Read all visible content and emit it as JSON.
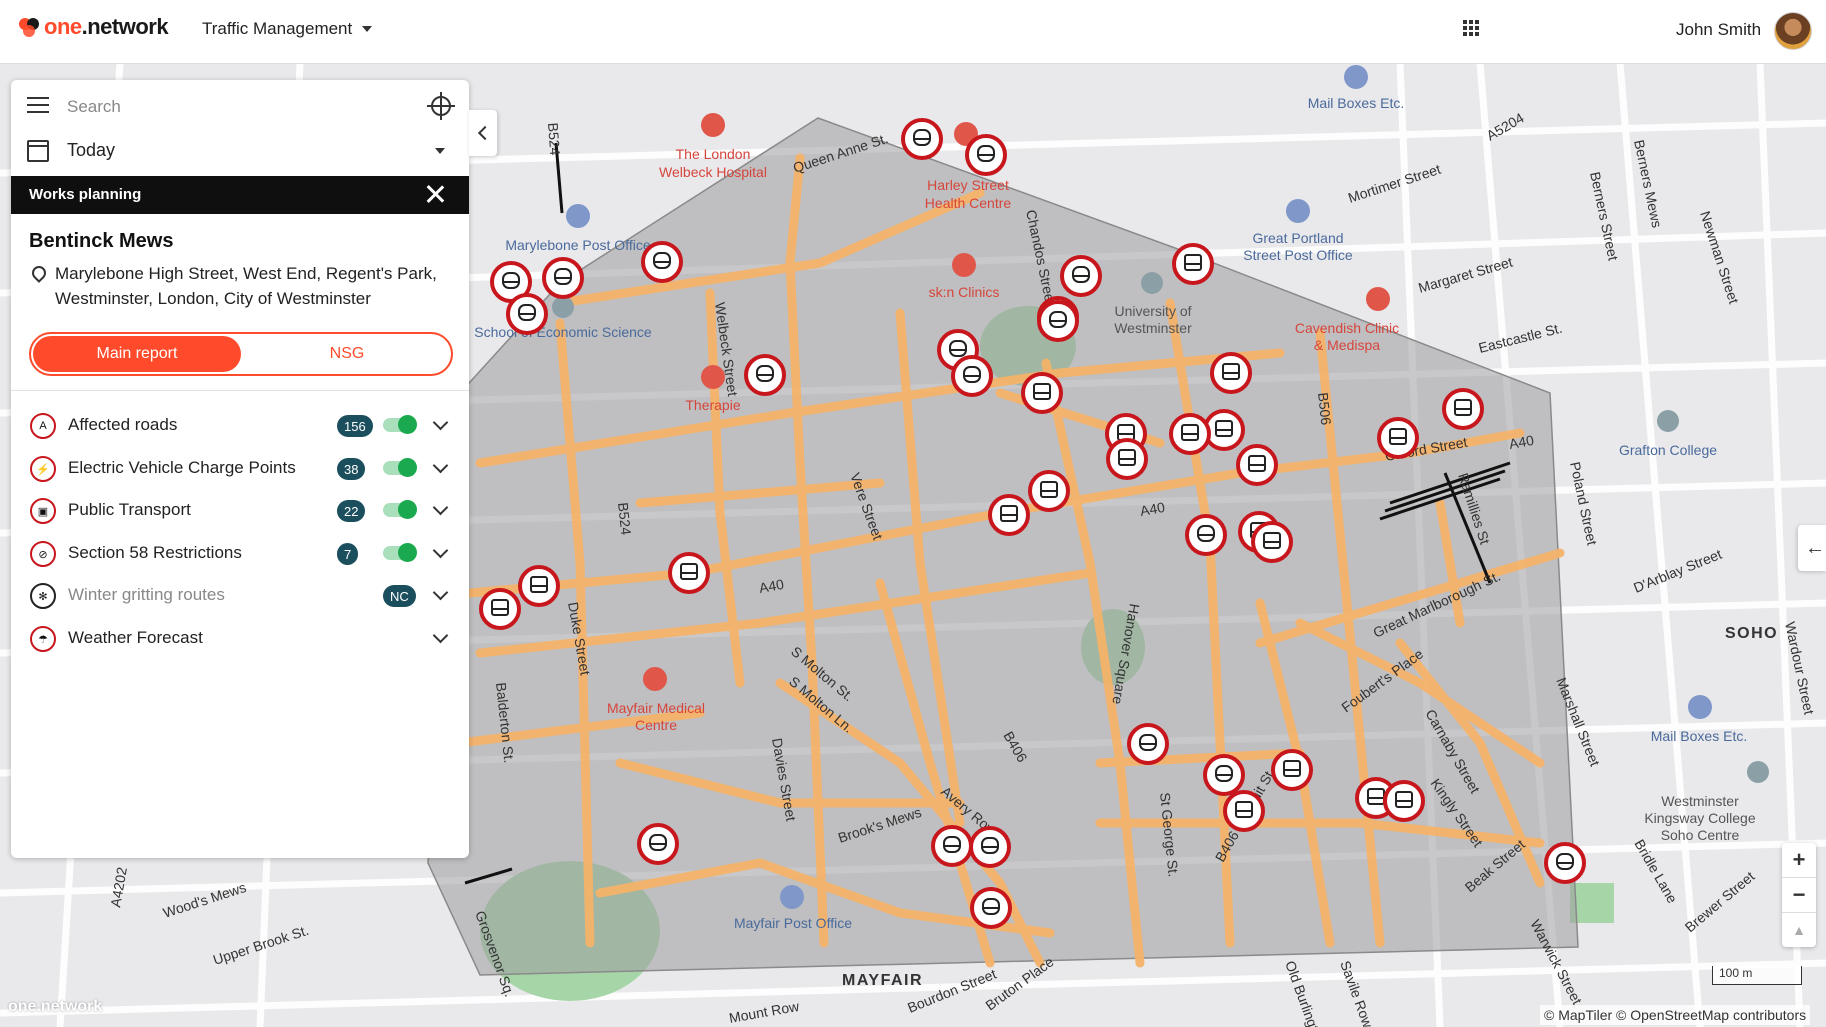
{
  "header": {
    "logo_text_a": "one",
    "logo_text_b": ".network",
    "app_name": "Traffic Management",
    "user_name": "John Smith"
  },
  "panel": {
    "search_placeholder": "Search",
    "date_value": "Today",
    "section_title": "Works planning",
    "location_title": "Bentinck Mews",
    "location_address": "Marylebone High Street, West End, Regent's Park, Westminster, London, City of Westminster",
    "tabs": [
      {
        "label": "Main report",
        "active": true
      },
      {
        "label": "NSG",
        "active": false
      }
    ],
    "layers": [
      {
        "label": "Affected roads",
        "count": "156",
        "toggle": true,
        "icon": "road-closed-icon"
      },
      {
        "label": "Electric Vehicle Charge Points",
        "count": "38",
        "toggle": true,
        "icon": "ev-charge-icon"
      },
      {
        "label": "Public Transport",
        "count": "22",
        "toggle": true,
        "icon": "bus-icon"
      },
      {
        "label": "Section 58 Restrictions",
        "count": "7",
        "toggle": true,
        "icon": "restriction-icon"
      },
      {
        "label": "Winter gritting routes",
        "count": "NC",
        "toggle": false,
        "icon": "snowflake-icon"
      },
      {
        "label": "Weather Forecast",
        "count": "",
        "toggle": false,
        "icon": "weather-icon"
      }
    ]
  },
  "map": {
    "streets": [
      "Queen Anne St.",
      "Welbeck Street",
      "Chandos Street",
      "Mortimer Street",
      "Margaret Street",
      "Eastcastle St.",
      "Oxford Street",
      "A40",
      "Great Marlborough St.",
      "Foubert's Place",
      "Carnaby Street",
      "Kingly Street",
      "Beak Street",
      "Warwick Street",
      "Savile Row",
      "Old Burlington",
      "Conduit St",
      "St George St.",
      "Hanover Square",
      "B406",
      "Avery Row",
      "Brook's Mews",
      "Davies Street",
      "S Molton St.",
      "S Molton Ln.",
      "Duke Street",
      "Balderton St.",
      "B524",
      "Vere Street",
      "Grosvenor Sq.",
      "Upper Brook St.",
      "Wood's Mews",
      "A4202",
      "Mount Row",
      "Bourdon Street",
      "Bruton Place",
      "Marshall Street",
      "Poland Street",
      "D'Arblay Street",
      "Berners Street",
      "Newman Street",
      "Berners Mews",
      "Bridle Lane",
      "Brewer Street",
      "Ramillies St",
      "Wardour Street",
      "A5204",
      "B506"
    ],
    "places": [
      "The London Welbeck Hospital",
      "Harley Street Health Centre",
      "sk:n Clinics",
      "Therapie",
      "Marylebone Post Office",
      "School of Economic Science",
      "University of Westminster",
      "Great Portland Street Post Office",
      "Mail Boxes Etc.",
      "Cavendish Clinic & Medispa",
      "Grafton College",
      "Mayfair Medical Centre",
      "Mayfair Post Office",
      "Westminster Kingsway College Soho Centre",
      "Mail Boxes Etc."
    ],
    "districts": [
      "MAYFAIR",
      "SOHO"
    ],
    "scale_label": "100 m",
    "attribution": "© MapTiler © OpenStreetMap contributors",
    "watermark": "one.network"
  },
  "colors": {
    "brand": "#ff4b2b",
    "road_highlight": "#f5b36a",
    "badge": "#1c4f5e",
    "toggle_on": "#1aa94e",
    "marker_red": "#c8161d"
  }
}
